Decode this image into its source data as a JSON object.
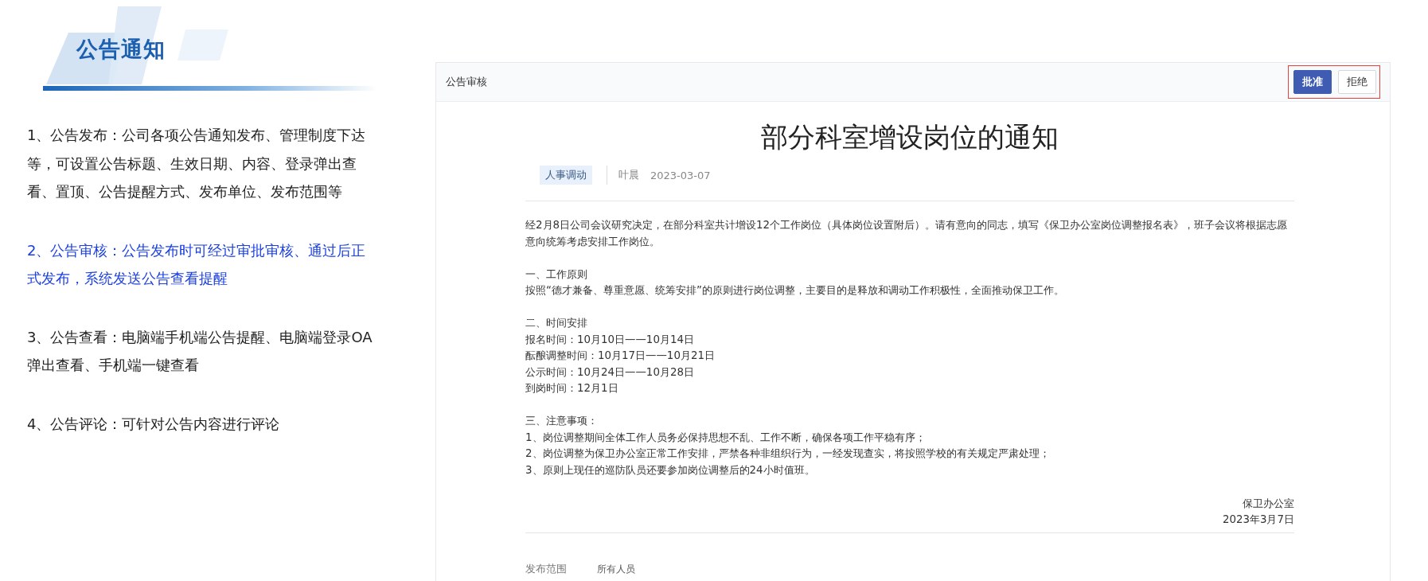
{
  "intro": {
    "title": "公告通知",
    "items": [
      {
        "text": "1、公告发布：公司各项公告通知发布、管理制度下达等，可设置公告标题、生效日期、内容、登录弹出查看、置顶、公告提醒方式、发布单位、发布范围等",
        "selected": false
      },
      {
        "text": "2、公告审核：公告发布时可经过审批审核、通过后正式发布，系统发送公告查看提醒",
        "selected": true
      },
      {
        "text": "3、公告查看：电脑端手机端公告提醒、电脑端登录OA弹出查看、手机端一键查看",
        "selected": false
      },
      {
        "text": "4、公告评论：可针对公告内容进行评论",
        "selected": false
      }
    ]
  },
  "panel": {
    "title": "公告审核",
    "buttons": [
      {
        "label": "批准",
        "kind": "primary"
      },
      {
        "label": "拒绝",
        "kind": "default"
      }
    ],
    "notice": {
      "title": "部分科室增设岗位的通知",
      "tag": "人事调动",
      "author": "叶晨",
      "date": "2023-03-07",
      "paragraph": "经2月8日公司会议研究决定，在部分科室共计增设12个工作岗位（具体岗位设置附后）。请有意向的同志，填写《保卫办公室岗位调整报名表》，班子会议将根据志愿意向统筹考虑安排工作岗位。",
      "sections": [
        {
          "heading": "一、工作原则",
          "lines": [
            "按照“德才兼备、尊重意愿、统筹安排”的原则进行岗位调整，主要目的是释放和调动工作积极性，全面推动保卫工作。"
          ]
        },
        {
          "heading": "二、时间安排",
          "lines": [
            "报名时间：10月10日——10月14日",
            "酝酿调整时间：10月17日——10月21日",
            "公示时间：10月24日——10月28日",
            "到岗时间：12月1日"
          ]
        },
        {
          "heading": "三、注意事项：",
          "lines": [
            "1、岗位调整期间全体工作人员务必保持思想不乱、工作不断，确保各项工作平稳有序；",
            "2、岗位调整为保卫办公室正常工作安排，严禁各种非组织行为，一经发现查实，将按照学校的有关规定严肃处理；",
            "3、原则上现任的巡防队员还要参加岗位调整后的24小时值班。"
          ]
        }
      ],
      "signature": "保卫办公室",
      "signature_date": "2023年3月7日",
      "scope_label": "发布范围",
      "scope_value": "所有人员"
    }
  }
}
